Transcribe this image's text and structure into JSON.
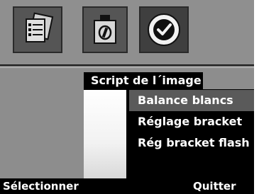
{
  "menu": {
    "title": "Script de l´image",
    "items": [
      {
        "label": "Balance blancs",
        "selected": true
      },
      {
        "label": "Réglage bracket",
        "selected": false
      },
      {
        "label": "Rég bracket flash",
        "selected": false
      }
    ]
  },
  "tabs": [
    {
      "icon": "script-list-icon",
      "selected": false
    },
    {
      "icon": "print-icon",
      "selected": false
    },
    {
      "icon": "setup-check-icon",
      "selected": true
    }
  ],
  "softkeys": {
    "left_label": "Sélectionner",
    "right_label": "Quitter"
  },
  "colors": {
    "screen_bg": "#8d8d8d",
    "highlight": "#5a5a5a",
    "bar": "#000000",
    "text": "#ffffff"
  }
}
